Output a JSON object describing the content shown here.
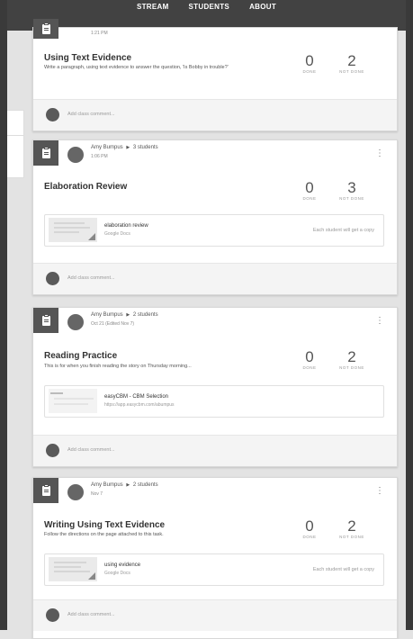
{
  "nav": [
    "STREAM",
    "STUDENTS",
    "ABOUT"
  ],
  "cards": [
    {
      "date": "1:21 PM",
      "title": "Using Text Evidence",
      "description": "Write a paragraph, using text evidence to answer the question, 'Is Bobby in trouble?'",
      "done": "0",
      "done_label": "DONE",
      "not_done": "2",
      "not_done_label": "NOT DONE",
      "comment_placeholder": "Add class comment..."
    },
    {
      "author": "Amy Bumpus",
      "arrow": "▶",
      "recipients": "3 students",
      "date": "1:06 PM",
      "title": "Elaboration Review",
      "done": "0",
      "done_label": "DONE",
      "not_done": "3",
      "not_done_label": "NOT DONE",
      "attachment": {
        "title": "elaboration review",
        "subtitle": "Google Docs",
        "right": "Each student will get a copy"
      },
      "comment_placeholder": "Add class comment..."
    },
    {
      "author": "Amy Bumpus",
      "arrow": "▶",
      "recipients": "2 students",
      "date": "Oct 21 (Edited Nov 7)",
      "title": "Reading Practice",
      "description": "This is for when you finish reading the story on Thursday morning...",
      "done": "0",
      "done_label": "DONE",
      "not_done": "2",
      "not_done_label": "NOT DONE",
      "attachment": {
        "title": "easyCBM - CBM Selection",
        "subtitle": "https://app.easycbm.com/abumpus"
      },
      "comment_placeholder": "Add class comment..."
    },
    {
      "author": "Amy Bumpus",
      "arrow": "▶",
      "recipients": "2 students",
      "date": "Nov 7",
      "title": "Writing Using Text Evidence",
      "description": "Follow the directions on the page attached to this task.",
      "done": "0",
      "done_label": "DONE",
      "not_done": "2",
      "not_done_label": "NOT DONE",
      "attachment": {
        "title": "using evidence",
        "subtitle": "Google Docs",
        "right": "Each student will get a copy"
      },
      "comment_placeholder": "Add class comment..."
    }
  ],
  "colors": {
    "topbar": "#424242",
    "icon_bg": "#555555",
    "page_bg": "#e3e3e3"
  },
  "icons": {
    "assignment": "clipboard-icon",
    "menu": "kebab-menu-icon"
  }
}
